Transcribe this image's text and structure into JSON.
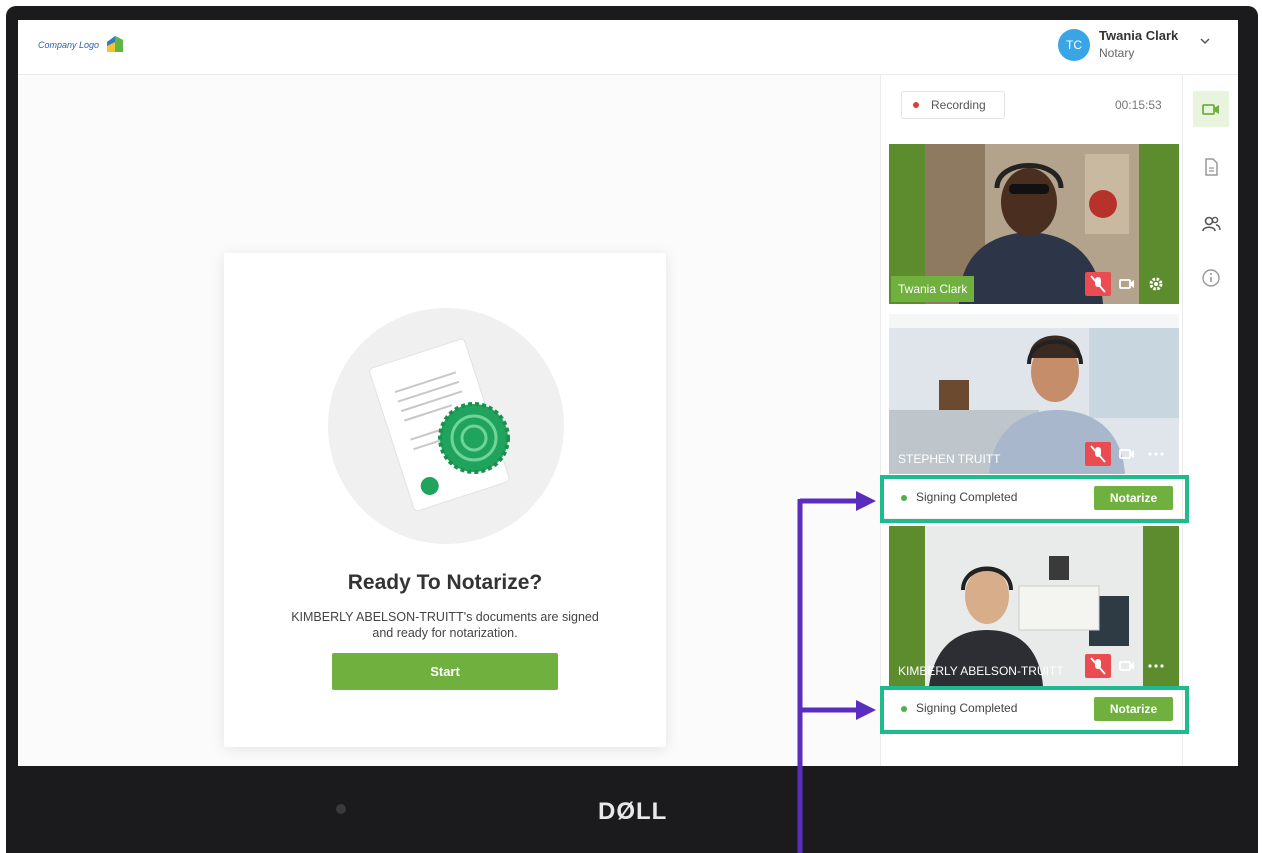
{
  "header": {
    "logo_text": "Company Logo",
    "avatar_initials": "TC",
    "user_name": "Twania Clark",
    "user_role": "Notary"
  },
  "main": {
    "title": "Ready To Notarize?",
    "description": "KIMBERLY ABELSON-TRUITT's documents are signed and ready for notarization.",
    "start_label": "Start"
  },
  "sidebar": {
    "recording_label": "Recording",
    "timer": "00:15:53",
    "participants": [
      {
        "name": "Twania Clark"
      },
      {
        "name": "STEPHEN TRUITT",
        "status": "Signing Completed",
        "action": "Notarize"
      },
      {
        "name": "KIMBERLY ABELSON-TRUITT",
        "status": "Signing Completed",
        "action": "Notarize"
      }
    ]
  },
  "rail": {
    "items": [
      "video-icon",
      "document-icon",
      "participants-icon",
      "info-icon"
    ]
  },
  "device": {
    "brand": "DØLL"
  },
  "colors": {
    "accent_green": "#6fb03e",
    "highlight": "#1dbb8d",
    "annotation_purple": "#5a2dbf",
    "mic_off_red": "#ea4c52",
    "avatar_blue": "#3aa5e6"
  }
}
